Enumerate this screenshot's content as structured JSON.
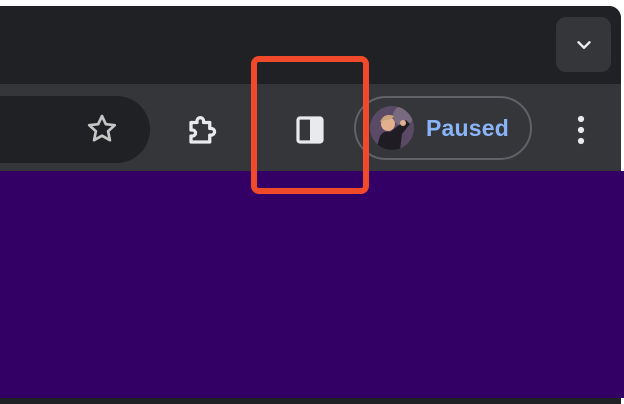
{
  "profile": {
    "label": "Paused"
  },
  "icons": {
    "tab_search": "chevron-down-icon",
    "bookmark": "star-icon",
    "extensions": "puzzle-icon",
    "side_panel": "side-panel-icon",
    "menu": "three-dot-menu-icon"
  },
  "colors": {
    "frame": "#202124",
    "toolbar": "#35363a",
    "profile_text": "#8ab4f8",
    "page_background": "#330066",
    "highlight": "#f04a2a"
  }
}
